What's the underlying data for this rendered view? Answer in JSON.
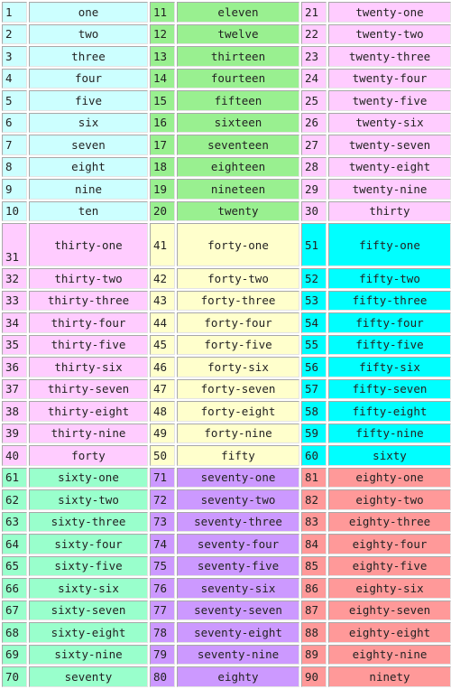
{
  "colors": {
    "block1": [
      "#ccffff",
      "#99f090",
      "#ffccff"
    ],
    "block2": [
      "#ffccff",
      "#ffffcc",
      "#00ffff"
    ],
    "block3": [
      "#99ffcc",
      "#cc99ff",
      "#ff9999"
    ]
  },
  "rows": [
    [
      [
        "1",
        "one"
      ],
      [
        "11",
        "eleven"
      ],
      [
        "21",
        "twenty-one"
      ]
    ],
    [
      [
        "2",
        "two"
      ],
      [
        "12",
        "twelve"
      ],
      [
        "22",
        "twenty-two"
      ]
    ],
    [
      [
        "3",
        "three"
      ],
      [
        "13",
        "thirteen"
      ],
      [
        "23",
        "twenty-three"
      ]
    ],
    [
      [
        "4",
        "four"
      ],
      [
        "14",
        "fourteen"
      ],
      [
        "24",
        "twenty-four"
      ]
    ],
    [
      [
        "5",
        "five"
      ],
      [
        "15",
        "fifteen"
      ],
      [
        "25",
        "twenty-five"
      ]
    ],
    [
      [
        "6",
        "six"
      ],
      [
        "16",
        "sixteen"
      ],
      [
        "26",
        "twenty-six"
      ]
    ],
    [
      [
        "7",
        "seven"
      ],
      [
        "17",
        "seventeen"
      ],
      [
        "27",
        "twenty-seven"
      ]
    ],
    [
      [
        "8",
        "eight"
      ],
      [
        "18",
        "eighteen"
      ],
      [
        "28",
        "twenty-eight"
      ]
    ],
    [
      [
        "9",
        "nine"
      ],
      [
        "19",
        "nineteen"
      ],
      [
        "29",
        "twenty-nine"
      ]
    ],
    [
      [
        "10",
        "ten"
      ],
      [
        "20",
        "twenty"
      ],
      [
        "30",
        "thirty"
      ]
    ],
    [
      [
        "31",
        "thirty-one"
      ],
      [
        "41",
        "forty-one"
      ],
      [
        "51",
        "fifty-one"
      ]
    ],
    [
      [
        "32",
        "thirty-two"
      ],
      [
        "42",
        "forty-two"
      ],
      [
        "52",
        "fifty-two"
      ]
    ],
    [
      [
        "33",
        "thirty-three"
      ],
      [
        "43",
        "forty-three"
      ],
      [
        "53",
        "fifty-three"
      ]
    ],
    [
      [
        "34",
        "thirty-four"
      ],
      [
        "44",
        "forty-four"
      ],
      [
        "54",
        "fifty-four"
      ]
    ],
    [
      [
        "35",
        "thirty-five"
      ],
      [
        "45",
        "forty-five"
      ],
      [
        "55",
        "fifty-five"
      ]
    ],
    [
      [
        "36",
        "thirty-six"
      ],
      [
        "46",
        "forty-six"
      ],
      [
        "56",
        "fifty-six"
      ]
    ],
    [
      [
        "37",
        "thirty-seven"
      ],
      [
        "47",
        "forty-seven"
      ],
      [
        "57",
        "fifty-seven"
      ]
    ],
    [
      [
        "38",
        "thirty-eight"
      ],
      [
        "48",
        "forty-eight"
      ],
      [
        "58",
        "fifty-eight"
      ]
    ],
    [
      [
        "39",
        "thirty-nine"
      ],
      [
        "49",
        "forty-nine"
      ],
      [
        "59",
        "fifty-nine"
      ]
    ],
    [
      [
        "40",
        "forty"
      ],
      [
        "50",
        "fifty"
      ],
      [
        "60",
        "sixty"
      ]
    ],
    [
      [
        "61",
        "sixty-one"
      ],
      [
        "71",
        "seventy-one"
      ],
      [
        "81",
        "eighty-one"
      ]
    ],
    [
      [
        "62",
        "sixty-two"
      ],
      [
        "72",
        "seventy-two"
      ],
      [
        "82",
        "eighty-two"
      ]
    ],
    [
      [
        "63",
        "sixty-three"
      ],
      [
        "73",
        "seventy-three"
      ],
      [
        "83",
        "eighty-three"
      ]
    ],
    [
      [
        "64",
        "sixty-four"
      ],
      [
        "74",
        "seventy-four"
      ],
      [
        "84",
        "eighty-four"
      ]
    ],
    [
      [
        "65",
        "sixty-five"
      ],
      [
        "75",
        "seventy-five"
      ],
      [
        "85",
        "eighty-five"
      ]
    ],
    [
      [
        "66",
        "sixty-six"
      ],
      [
        "76",
        "seventy-six"
      ],
      [
        "86",
        "eighty-six"
      ]
    ],
    [
      [
        "67",
        "sixty-seven"
      ],
      [
        "77",
        "seventy-seven"
      ],
      [
        "87",
        "eighty-seven"
      ]
    ],
    [
      [
        "68",
        "sixty-eight"
      ],
      [
        "78",
        "seventy-eight"
      ],
      [
        "88",
        "eighty-eight"
      ]
    ],
    [
      [
        "69",
        "sixty-nine"
      ],
      [
        "79",
        "seventy-nine"
      ],
      [
        "89",
        "eighty-nine"
      ]
    ],
    [
      [
        "70",
        "seventy"
      ],
      [
        "80",
        "eighty"
      ],
      [
        "90",
        "ninety"
      ]
    ]
  ]
}
